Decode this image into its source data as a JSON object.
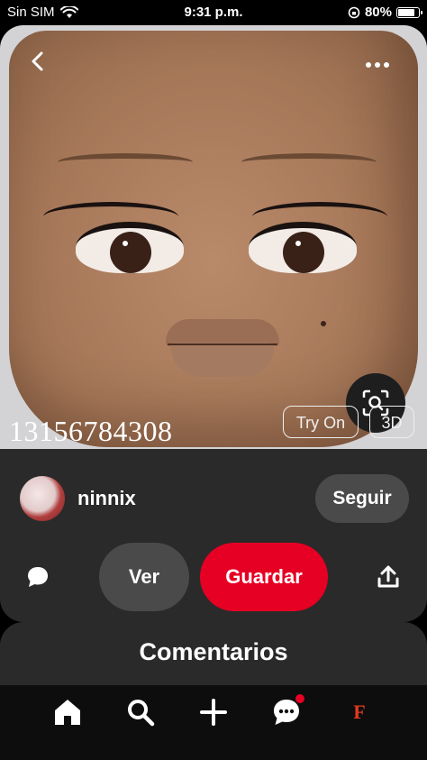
{
  "status_bar": {
    "carrier": "Sin SIM",
    "time": "9:31 p.m.",
    "battery": "80%",
    "battery_level": 0.8
  },
  "pin": {
    "image_caption": "13156784308",
    "try_on_label": "Try On",
    "three_d_label": "3D"
  },
  "creator": {
    "username": "ninnix",
    "follow_label": "Seguir"
  },
  "actions": {
    "view_label": "Ver",
    "save_label": "Guardar"
  },
  "comments": {
    "title": "Comentarios"
  },
  "nav": {
    "items": [
      "home-icon",
      "search-icon",
      "plus-icon",
      "messages-icon",
      "profile-icon"
    ],
    "profile_initial": "F"
  },
  "colors": {
    "accent": "#e60023",
    "card_bg": "#2a2a2a",
    "secondary_button": "#4a4a4a"
  }
}
